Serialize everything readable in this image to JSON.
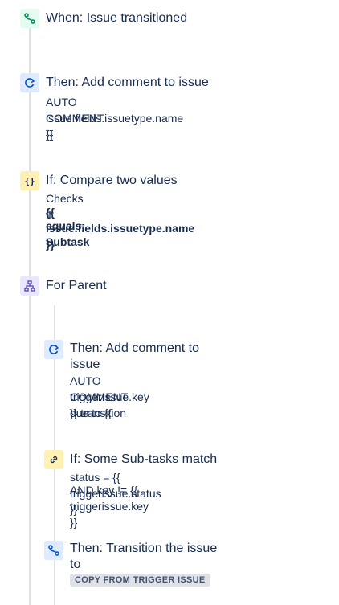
{
  "colors": {
    "trigger_green": "#00875A",
    "action_blue": "#0052CC",
    "condition_yellow": "#FF8B00",
    "branch_purple": "#5243AA",
    "rail": "#DFE1E6"
  },
  "steps": [
    {
      "icon": "transition-icon",
      "title": "When: Issue transitioned"
    },
    {
      "icon": "comment-action-icon",
      "title": "Then: Add comment to issue",
      "lines": [
        "AUTO COMMENT {{",
        "issue.fields.issuetype.name }}"
      ]
    },
    {
      "icon": "braces-icon",
      "title": "If: Compare two values",
      "lines": [
        "Checks if:"
      ],
      "strong_lines": [
        "{{ issue.fields.issuetype.name }}",
        "equals Subtask"
      ]
    },
    {
      "icon": "hierarchy-icon",
      "title": "For Parent"
    },
    {
      "icon": "comment-action-icon",
      "title_lines": [
        "Then: Add comment to",
        "issue"
      ],
      "lines": [
        "AUTO COMMENT due to {{",
        "triggerIssue.key }} transition"
      ]
    },
    {
      "icon": "link-icon",
      "title": "If: Some Sub-tasks match",
      "lines": [
        "status = {{ triggerissue.status }}",
        "AND key != {{ triggerissue.key }}"
      ]
    },
    {
      "icon": "transition-icon",
      "title_lines": [
        "Then: Transition the issue",
        "to"
      ],
      "badge": "COPY FROM TRIGGER ISSUE"
    }
  ]
}
